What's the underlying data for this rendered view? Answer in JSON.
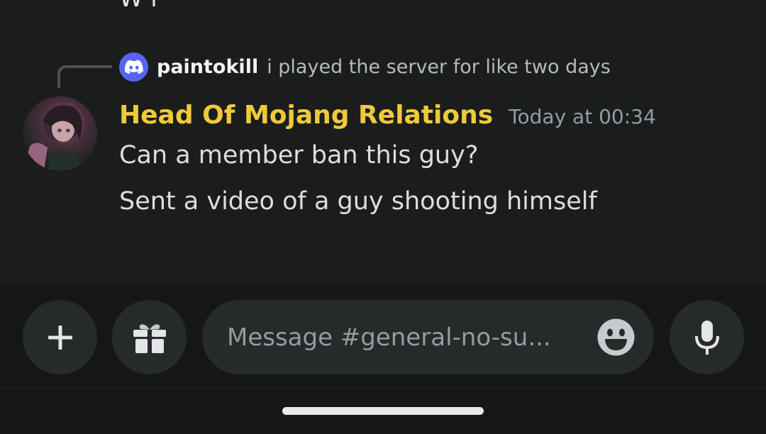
{
  "chat": {
    "previous_message_fragment": "W r",
    "reply": {
      "author": "paintokill",
      "text": "i played the server for like two days",
      "avatar_icon": "discord-logo-icon"
    },
    "message": {
      "author": "Head Of Mojang Relations",
      "timestamp": "Today at 00:34",
      "lines": [
        "Can a member ban this guy?",
        "Sent a video of a guy shooting himself"
      ]
    }
  },
  "composer": {
    "placeholder": "Message #general-no-su...",
    "buttons": {
      "add": "plus-icon",
      "gift": "gift-icon",
      "emoji": "emoji-icon",
      "voice": "microphone-icon"
    }
  },
  "colors": {
    "background": "#1a1d1c",
    "author_name": "#f0c93b",
    "discord_blurple": "#5865f2"
  }
}
